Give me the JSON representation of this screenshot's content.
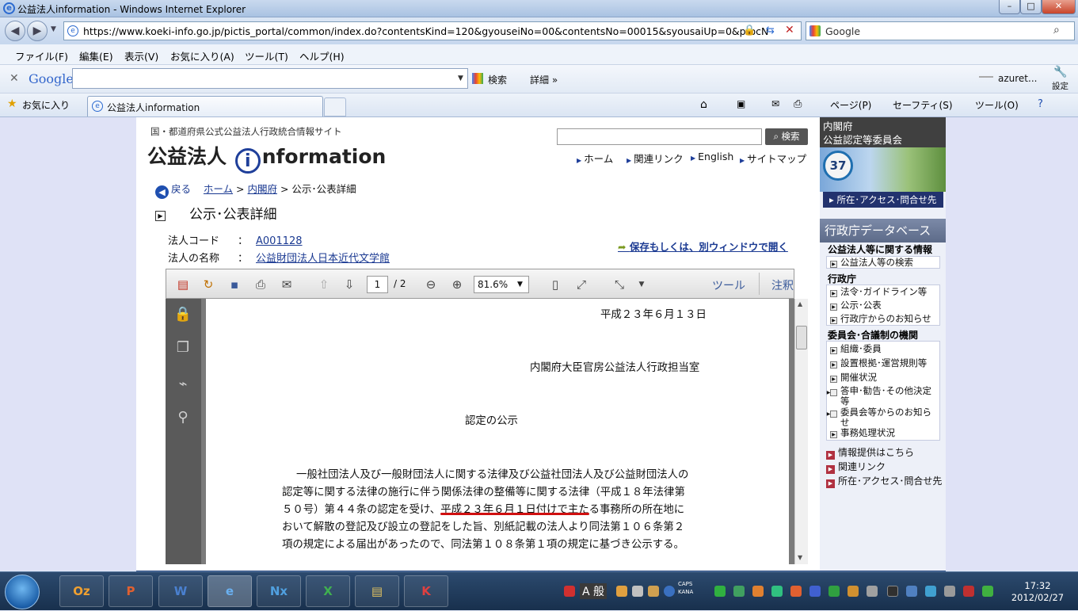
{
  "window": {
    "title": "公益法人information - Windows Internet Explorer",
    "url": "https://www.koeki-info.go.jp/pictis_portal/common/index.do?contentsKind=120&gyouseiNo=00&contentsNo=00015&syousaiUp=0&procN",
    "search_engine": "Google",
    "minimize": "–",
    "maximize": "□",
    "close": "✕"
  },
  "menu": [
    "ファイル(F)",
    "編集(E)",
    "表示(V)",
    "お気に入り(A)",
    "ツール(T)",
    "ヘルプ(H)"
  ],
  "google_toolbar": {
    "logo": "Google",
    "search_btn": "検索",
    "more": "詳細 »",
    "account": "azuret...",
    "settings": "設定"
  },
  "favbar": {
    "favorites": "お気に入り",
    "tab_title": "公益法人information",
    "commands": [
      "ページ(P)",
      "セーフティ(S)",
      "ツール(O)"
    ]
  },
  "site": {
    "subtitle": "国・都道府県公式公益法人行政統合情報サイト",
    "logo_pre": "公益法人",
    "logo_i": "i",
    "logo_post": "nformation",
    "search_btn": "検索",
    "nav": [
      "ホーム",
      "関連リンク",
      "English",
      "サイトマップ"
    ],
    "breadcrumb": {
      "back": "戻る",
      "home": "ホーム",
      "office": "内閣府",
      "current": "公示･公表詳細"
    },
    "page_title": "公示･公表詳細",
    "fields": [
      {
        "label": "法人コード",
        "value": "A001128"
      },
      {
        "label": "法人の名称",
        "value": "公益財団法人日本近代文学館"
      }
    ],
    "open_window": "保存もしくは、別ウィンドウで開く"
  },
  "pdf": {
    "page": "1",
    "total": "/ 2",
    "zoom": "81.6%",
    "tools": "ツール",
    "comment": "注釈",
    "date": "平成２３年６月１３日",
    "office": "内閣府大臣官房公益法人行政担当室",
    "heading": "認定の公示",
    "body": [
      "一般社団法人及び一般財団法人に関する法律及び公益社団法人及び公益財団法人の",
      "認定等に関する法律の施行に伴う関係法律の整備等に関する法律（平成１８年法律第",
      "５０号）第４４条の認定を受け、平成２３年６月１日付けで主たる事務所の所在地に",
      "おいて解散の登記及び設立の登記をした旨、別紙記載の法人より同法第１０６条第２",
      "項の規定による届出があったので、同法第１０８条第１項の規定に基づき公示する。"
    ]
  },
  "sidebar": {
    "top1": "内閣府",
    "top2": "公益認定等委員会",
    "badge": "37",
    "access": "所在･アクセス･問合せ先",
    "db_title": "行政庁データベース",
    "sec1": "公益法人等に関する情報",
    "sec1_items": [
      "公益法人等の検索"
    ],
    "sec2": "行政庁",
    "sec2_items": [
      "法令･ガイドライン等",
      "公示･公表",
      "行政庁からのお知らせ"
    ],
    "sec3": "委員会･合議制の機関",
    "sec3_items": [
      "組織･委員",
      "設置根拠･運営規則等",
      "開催状況",
      "答申･勧告･その他決定等",
      "委員会等からのお知らせ",
      "事務処理状況"
    ],
    "links": [
      "情報提供はこちら",
      "関連リンク",
      "所在･アクセス･問合せ先"
    ]
  },
  "taskbar": {
    "apps": [
      "Oz",
      "P",
      "W",
      "e",
      "Nx",
      "X",
      "▤",
      "K"
    ],
    "ime": "A 般",
    "caps": "CAPS",
    "kana": "KANA",
    "time": "17:32",
    "date": "2012/02/27"
  },
  "colors": {
    "link": "#1b3a92",
    "accent": "#8a1f2f",
    "highlight_underline": "#d01010"
  }
}
